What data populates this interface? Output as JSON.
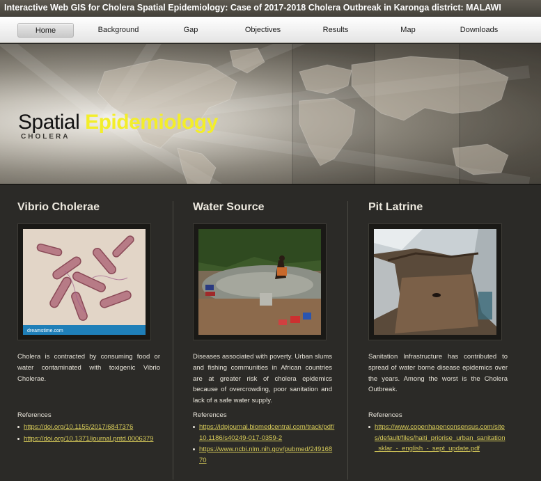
{
  "header": {
    "title": "Interactive Web GIS for Cholera Spatial Epidemiology: Case of 2017-2018 Cholera Outbreak in Karonga district: MALAWI"
  },
  "nav": {
    "items": [
      {
        "label": "Home",
        "active": true
      },
      {
        "label": "Background",
        "active": false
      },
      {
        "label": "Gap",
        "active": false
      },
      {
        "label": "Objectives",
        "active": false
      },
      {
        "label": "Results",
        "active": false
      },
      {
        "label": "Map",
        "active": false
      },
      {
        "label": "Downloads",
        "active": false
      }
    ]
  },
  "banner": {
    "title_word1": "Spatial",
    "title_word2": "Epidemiology",
    "subtitle": "CHOLERA"
  },
  "columns": [
    {
      "heading": "Vibrio Cholerae",
      "image_watermark": "dreamstime.com",
      "description": "Cholera is contracted by consuming food or water contaminated with toxigenic Vibrio Cholerae.",
      "references_label": "References",
      "references": [
        "https://doi.org/10.1155/2017/6847376",
        "https://doi.org/10.1371/journal.pntd.0006379"
      ]
    },
    {
      "heading": "Water Source",
      "description": "Diseases associated with poverty. Urban slums and fishing communities in African countries are at greater risk of cholera epidemics because of overcrowding, poor sanitation and lack of a safe water supply.",
      "references_label": "References",
      "references": [
        "https://idpjournal.biomedcentral.com/track/pdf/10.1186/s40249-017-0359-2",
        "https://www.ncbi.nlm.nih.gov/pubmed/24916870"
      ]
    },
    {
      "heading": "Pit Latrine",
      "description": "Sanitation Infrastructure has contributed to spread of water borne disease epidemics over the years. Among the worst is the Cholera Outbreak.",
      "references_label": "References",
      "references": [
        "https://www.copenhagenconsensus.com/sites/default/files/haiti_priorise_urban_sanitation_sklar_-_english_-_sept_update.pdf"
      ]
    }
  ],
  "colors": {
    "background": "#2b2a27",
    "heading": "#ece8de",
    "link": "#d8cc5a",
    "banner_accent": "#f3ee2a"
  }
}
